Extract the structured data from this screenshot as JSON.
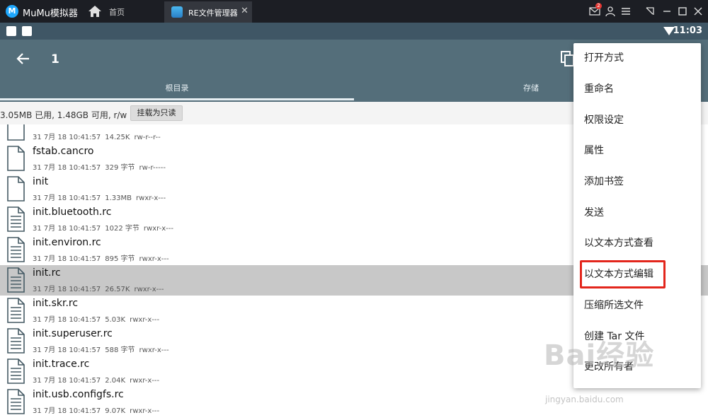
{
  "titlebar": {
    "app_name": "MuMu模拟器",
    "home_label": "首页",
    "tab_label": "RE文件管理器",
    "tab_close": "✕",
    "mail_badge": "2"
  },
  "statusbar": {
    "time": "11:03"
  },
  "appbar": {
    "title": "1",
    "tabs": [
      {
        "label": "根目录"
      },
      {
        "label": "存储"
      }
    ]
  },
  "info": {
    "usage_text": "3.05MB 已用, 1.48GB 可用, r/w",
    "mount_button": "挂载为只读"
  },
  "files": [
    {
      "name": "",
      "date": "31 7月 18 10:41:57",
      "size": "14.25K",
      "perms": "rw-r--r--",
      "icon": "file-icon",
      "selected": false
    },
    {
      "name": "fstab.cancro",
      "date": "31 7月 18 10:41:57",
      "size": "329 字节",
      "perms": "rw-r-----",
      "icon": "file-icon",
      "selected": false
    },
    {
      "name": "init",
      "date": "31 7月 18 10:41:57",
      "size": "1.33MB",
      "perms": "rwxr-x---",
      "icon": "file-icon",
      "selected": false
    },
    {
      "name": "init.bluetooth.rc",
      "date": "31 7月 18 10:41:57",
      "size": "1022 字节",
      "perms": "rwxr-x---",
      "icon": "text-file-icon",
      "selected": false
    },
    {
      "name": "init.environ.rc",
      "date": "31 7月 18 10:41:57",
      "size": "895 字节",
      "perms": "rwxr-x---",
      "icon": "text-file-icon",
      "selected": false
    },
    {
      "name": "init.rc",
      "date": "31 7月 18 10:41:57",
      "size": "26.57K",
      "perms": "rwxr-x---",
      "icon": "text-file-icon",
      "selected": true
    },
    {
      "name": "init.skr.rc",
      "date": "31 7月 18 10:41:57",
      "size": "5.03K",
      "perms": "rwxr-x---",
      "icon": "text-file-icon",
      "selected": false
    },
    {
      "name": "init.superuser.rc",
      "date": "31 7月 18 10:41:57",
      "size": "588 字节",
      "perms": "rwxr-x---",
      "icon": "text-file-icon",
      "selected": false
    },
    {
      "name": "init.trace.rc",
      "date": "31 7月 18 10:41:57",
      "size": "2.04K",
      "perms": "rwxr-x---",
      "icon": "text-file-icon",
      "selected": false
    },
    {
      "name": "init.usb.configfs.rc",
      "date": "31 7月 18 10:41:57",
      "size": "9.07K",
      "perms": "rwxr-x---",
      "icon": "text-file-icon",
      "selected": false
    }
  ],
  "menu": {
    "items": [
      {
        "label": "打开方式"
      },
      {
        "label": "重命名"
      },
      {
        "label": "权限设定"
      },
      {
        "label": "属性"
      },
      {
        "label": "添加书签"
      },
      {
        "label": "发送"
      },
      {
        "label": "以文本方式查看"
      },
      {
        "label": "以文本方式编辑"
      },
      {
        "label": "压缩所选文件"
      },
      {
        "label": "创建 Tar 文件"
      },
      {
        "label": "更改所有者"
      }
    ]
  },
  "watermark": {
    "brand": "Bai经验",
    "url": "jingyan.baidu.com"
  },
  "colors": {
    "appbar": "#546e7a",
    "statusbar": "#3f5665",
    "highlight_box": "#e3261c",
    "selected_row": "#c8c8c8"
  }
}
